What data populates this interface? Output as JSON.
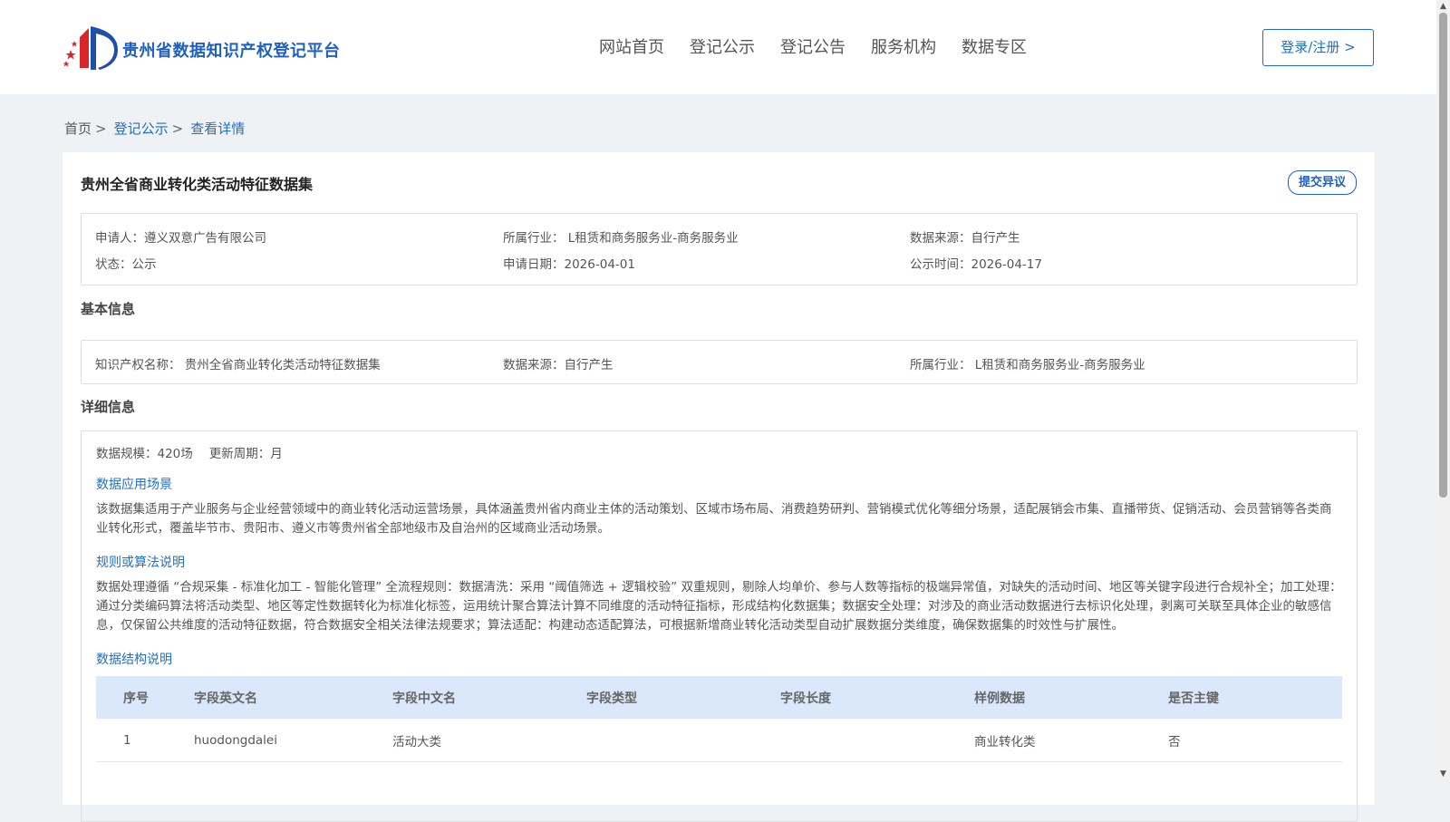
{
  "header": {
    "site_name": "贵州省数据知识产权登记平台",
    "nav": [
      "网站首页",
      "登记公示",
      "登记公告",
      "服务机构",
      "数据专区"
    ],
    "login_label": "登录/注册 >"
  },
  "breadcrumb": {
    "home": "首页",
    "publicity": "登记公示",
    "current": "查看详情",
    "separator": ">"
  },
  "detail": {
    "title": "贵州全省商业转化类活动特征数据集",
    "objection_label": "提交异议",
    "meta": {
      "applicant": "申请人：遵义双意广告有限公司",
      "industry": "所属行业： L租赁和商务服务业-商务服务业",
      "source": "数据来源：自行产生",
      "status": "状态：公示",
      "apply_date": "申请日期：2026-04-01",
      "publish_date": "公示时间：2026-04-17"
    },
    "basic_title": "基本信息",
    "basic": {
      "ip_name": "知识产权名称： 贵州全省商业转化类活动特征数据集",
      "source": "数据来源：自行产生",
      "industry": "所属行业： L租赁和商务服务业-商务服务业"
    },
    "detail_title": "详细信息",
    "scale": "数据规模：420场",
    "update_cycle": "更新周期：月",
    "scenario_title": "数据应用场景",
    "scenario_text": "该数据集适用于产业服务与企业经营领域中的商业转化活动运营场景，具体涵盖贵州省内商业主体的活动策划、区域市场布局、消费趋势研判、营销模式优化等细分场景，适配展销会市集、直播带货、促销活动、会员营销等各类商业转化形式，覆盖毕节市、贵阳市、遵义市等贵州省全部地级市及自治州的区域商业活动场景。",
    "rules_title": "规则或算法说明",
    "rules_text": "数据处理遵循 “合规采集 - 标准化加工 - 智能化管理” 全流程规则：数据清洗：采用 “阈值筛选 + 逻辑校验” 双重规则，剔除人均单价、参与人数等指标的极端异常值，对缺失的活动时间、地区等关键字段进行合规补全；加工处理：通过分类编码算法将活动类型、地区等定性数据转化为标准化标签，运用统计聚合算法计算不同维度的活动特征指标，形成结构化数据集；数据安全处理：对涉及的商业活动数据进行去标识化处理，剥离可关联至具体企业的敏感信息，仅保留公共维度的活动特征数据，符合数据安全相关法律法规要求；算法适配：构建动态适配算法，可根据新增商业转化活动类型自动扩展数据分类维度，确保数据集的时效性与扩展性。",
    "structure_title": "数据结构说明",
    "table": {
      "headers": [
        "序号",
        "字段英文名",
        "字段中文名",
        "字段类型",
        "字段长度",
        "样例数据",
        "是否主键"
      ],
      "rows": [
        [
          "1",
          "huodongdalei",
          "活动大类",
          "",
          "",
          "商业转化类",
          "否"
        ]
      ]
    }
  },
  "colors": {
    "brand": "#1f5fbf",
    "link": "#1f6fc9",
    "table_header_bg": "#dbe8fb",
    "page_bg": "#eff2f5"
  },
  "icons": {
    "logo": "flag-stars-logo-icon",
    "scroll_up": "triangle-up-icon",
    "scroll_down": "triangle-down-icon"
  }
}
